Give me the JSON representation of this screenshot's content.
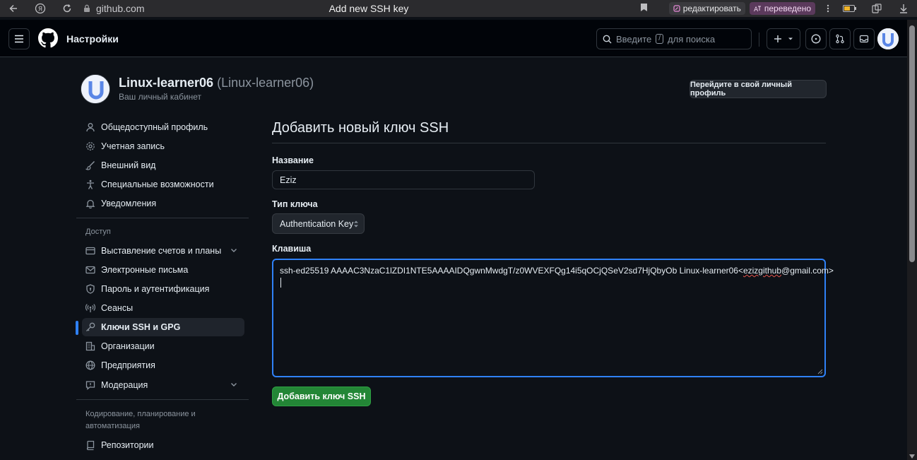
{
  "browser": {
    "url": "github.com",
    "tab_title": "Add new SSH key",
    "edit_label": "редактировать",
    "translated_label": "переведено"
  },
  "header": {
    "context": "Настройки",
    "search_prefix": "Введите",
    "search_key": "/",
    "search_suffix": "для поиска"
  },
  "profile": {
    "name": "Linux-learner06",
    "login": "(Linux-learner06)",
    "subtitle": "Ваш личный кабинет",
    "profile_button": "Перейдите в свой личный профиль"
  },
  "sidebar": {
    "items": [
      {
        "label": "Общедоступный профиль",
        "icon": "person-icon"
      },
      {
        "label": "Учетная запись",
        "icon": "gear-icon"
      },
      {
        "label": "Внешний вид",
        "icon": "paintbrush-icon"
      },
      {
        "label": "Специальные возможности",
        "icon": "accessibility-icon"
      },
      {
        "label": "Уведомления",
        "icon": "bell-icon"
      }
    ],
    "access_heading": "Доступ",
    "access_items": [
      {
        "label": "Выставление счетов и планы",
        "icon": "credit-card-icon",
        "expandable": true
      },
      {
        "label": "Электронные письма",
        "icon": "mail-icon"
      },
      {
        "label": "Пароль и аутентификация",
        "icon": "shield-lock-icon"
      },
      {
        "label": "Сеансы",
        "icon": "broadcast-icon"
      },
      {
        "label": "Ключи SSH и GPG",
        "icon": "key-icon",
        "active": true
      },
      {
        "label": "Организации",
        "icon": "organization-icon"
      },
      {
        "label": "Предприятия",
        "icon": "globe-icon"
      },
      {
        "label": "Модерация",
        "icon": "report-icon",
        "expandable": true
      }
    ],
    "code_heading": "Кодирование, планирование и автоматизация",
    "code_items": [
      {
        "label": "Репозитории",
        "icon": "repo-icon"
      }
    ]
  },
  "main": {
    "title": "Добавить новый ключ SSH",
    "name_label": "Название",
    "name_value": "Eziz",
    "type_label": "Тип ключа",
    "type_value": "Authentication Key",
    "key_label": "Клавиша",
    "key_value_prefix": "ssh-ed25519 AAAAC3NzaC1lZDI1NTE5AAAAIDQgwnMwdgT/z0WVEXFQg14i5qOCjQSeV2sd7HjQbyOb Linux-learner06<",
    "key_value_typo": "ezizgithub",
    "key_value_suffix": "@gmail.com>",
    "submit_label": "Добавить ключ SSH"
  },
  "colors": {
    "accent": "#2f81f7",
    "primary_button": "#238636",
    "background": "#0d1117"
  }
}
